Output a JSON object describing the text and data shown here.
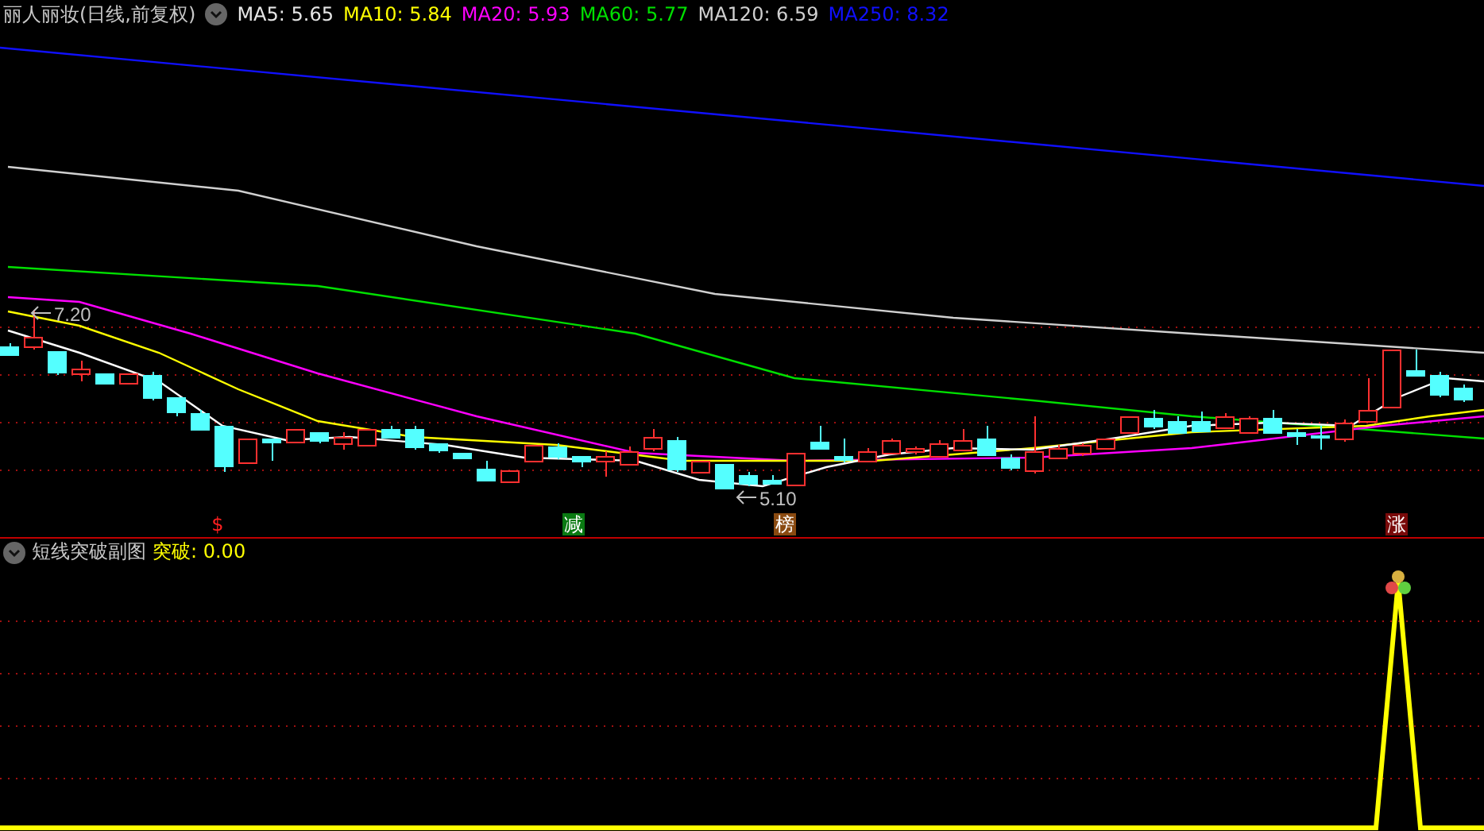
{
  "main_chart": {
    "title": "丽人丽妆(日线,前复权)",
    "indicators": [
      {
        "text": "MA5: 5.65",
        "color": "#e6e6e6"
      },
      {
        "text": "MA10: 5.84",
        "color": "#ffff00"
      },
      {
        "text": "MA20: 5.93",
        "color": "#ff00ff"
      },
      {
        "text": "MA60: 5.77",
        "color": "#00e000"
      },
      {
        "text": "MA120: 6.59",
        "color": "#d0d0d0"
      },
      {
        "text": "MA250: 8.32",
        "color": "#1010ff"
      }
    ],
    "price_labels": [
      {
        "text": "7.20"
      },
      {
        "text": "5.10"
      }
    ],
    "signals": [
      {
        "text": "$",
        "kind": "plain",
        "color": "#ff2020"
      },
      {
        "text": "减",
        "kind": "badge",
        "color": "#0a7a12"
      },
      {
        "text": "榜",
        "kind": "badge",
        "color": "#8a4a10"
      },
      {
        "text": "涨",
        "kind": "badge",
        "color": "#7a0a0a"
      }
    ]
  },
  "sub_chart": {
    "title": "短线突破副图",
    "indicator": "突破: 0.00"
  }
}
